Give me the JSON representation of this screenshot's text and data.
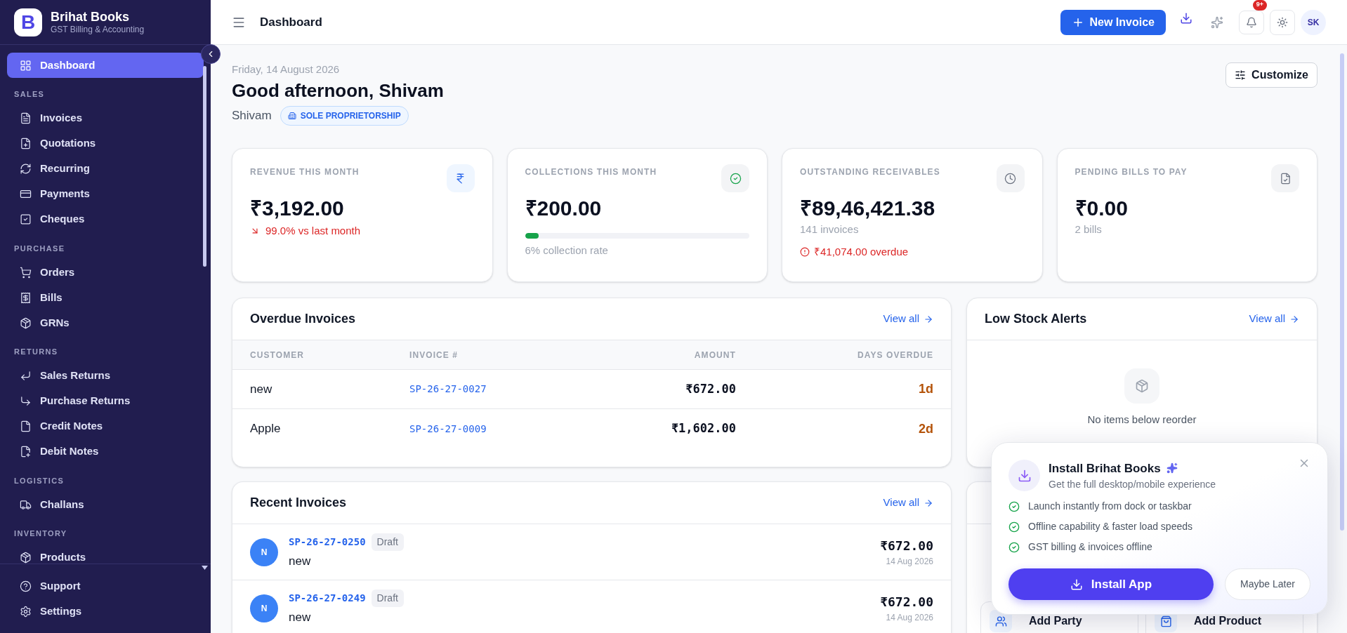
{
  "app": {
    "logo_letter": "B",
    "name": "Brihat Books",
    "tagline": "GST Billing & Accounting"
  },
  "sidebar": {
    "sections": [
      {
        "items": [
          {
            "label": "Dashboard",
            "selected": true
          }
        ]
      },
      {
        "title": "SALES",
        "items": [
          {
            "label": "Invoices",
            "selected": false
          },
          {
            "label": "Quotations",
            "selected": false
          },
          {
            "label": "Recurring",
            "selected": false
          },
          {
            "label": "Payments",
            "selected": false
          },
          {
            "label": "Cheques",
            "selected": false
          }
        ]
      },
      {
        "title": "PURCHASE",
        "items": [
          {
            "label": "Orders",
            "selected": false
          },
          {
            "label": "Bills",
            "selected": false
          },
          {
            "label": "GRNs",
            "selected": false
          }
        ]
      },
      {
        "title": "RETURNS",
        "items": [
          {
            "label": "Sales Returns",
            "selected": false
          },
          {
            "label": "Purchase Returns",
            "selected": false
          },
          {
            "label": "Credit Notes",
            "selected": false
          },
          {
            "label": "Debit Notes",
            "selected": false
          }
        ]
      },
      {
        "title": "LOGISTICS",
        "items": [
          {
            "label": "Challans",
            "selected": false
          }
        ]
      },
      {
        "title": "INVENTORY",
        "items": [
          {
            "label": "Products",
            "selected": false
          }
        ]
      }
    ],
    "footer": [
      {
        "label": "Support",
        "selected": false
      },
      {
        "label": "Settings",
        "selected": false
      }
    ]
  },
  "header": {
    "title": "Dashboard",
    "new_invoice": "New Invoice",
    "notification_badge": "9+",
    "avatar": "SK"
  },
  "greeting": {
    "date": "Friday, 14 August 2026",
    "title": "Good afternoon, Shivam",
    "name": "Shivam",
    "business_type": "SOLE PROPRIETORSHIP",
    "customize": "Customize"
  },
  "stats": [
    {
      "label": "REVENUE THIS MONTH",
      "value": "₹3,192.00",
      "trend": "99.0% vs last month"
    },
    {
      "label": "COLLECTIONS THIS MONTH",
      "value": "₹200.00",
      "level": 0.06,
      "note": "6% collection rate"
    },
    {
      "label": "OUTSTANDING RECEIVABLES",
      "value": "₹89,46,421.38",
      "note": "141 invoices",
      "alert": "₹41,074.00 overdue"
    },
    {
      "label": "PENDING BILLS TO PAY",
      "value": "₹0.00",
      "note": "2 bills"
    }
  ],
  "overdue": {
    "title": "Overdue Invoices",
    "view_all": "View all",
    "columns": [
      "CUSTOMER",
      "INVOICE #",
      "AMOUNT",
      "DAYS OVERDUE"
    ],
    "rows": [
      {
        "customer": "new",
        "invoice": "SP-26-27-0027",
        "amount": "₹672.00",
        "days": "1d"
      },
      {
        "customer": "Apple",
        "invoice": "SP-26-27-0009",
        "amount": "₹1,602.00",
        "days": "2d"
      }
    ]
  },
  "low_stock": {
    "title": "Low Stock Alerts",
    "view_all": "View all",
    "empty": "No items below reorder"
  },
  "recent": {
    "title": "Recent Invoices",
    "view_all": "View all",
    "rows": [
      {
        "initial": "N",
        "invoice": "SP-26-27-0250",
        "status": "Draft",
        "customer": "new",
        "amount": "₹672.00",
        "date": "14 Aug 2026"
      },
      {
        "initial": "N",
        "invoice": "SP-26-27-0249",
        "status": "Draft",
        "customer": "new",
        "amount": "₹672.00",
        "date": "14 Aug 2026"
      }
    ]
  },
  "quick_actions": {
    "actions": [
      "Add Party",
      "Add Product"
    ]
  },
  "install_popup": {
    "title": "Install Brihat Books",
    "subtitle": "Get the full desktop/mobile experience",
    "features": [
      "Launch instantly from dock or taskbar",
      "Offline capability & faster load speeds",
      "GST billing & invoices offline"
    ],
    "install": "Install App",
    "later": "Maybe Later"
  }
}
